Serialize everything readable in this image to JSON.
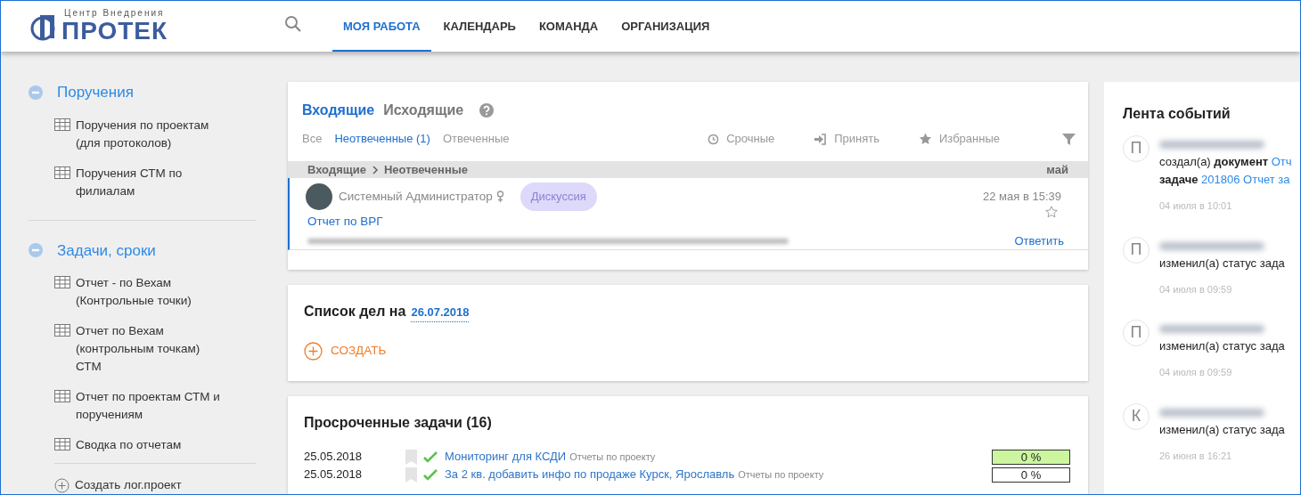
{
  "header": {
    "logo": {
      "subtitle": "Центр Внедрения",
      "name": "ПРОТЕК"
    },
    "nav": [
      {
        "label": "МОЯ РАБОТА",
        "selected": true
      },
      {
        "label": "КАЛЕНДАРЬ",
        "selected": false
      },
      {
        "label": "КОМАНДА",
        "selected": false
      },
      {
        "label": "ОРГАНИЗАЦИЯ",
        "selected": false
      }
    ]
  },
  "sidebar": {
    "sections": [
      {
        "title": "Поручения",
        "expanded": true,
        "items": [
          {
            "label": "Поручения по проектам (для протоколов)"
          },
          {
            "label": "Поручения СТМ по филиалам"
          }
        ]
      },
      {
        "title": "Задачи, сроки",
        "expanded": true,
        "items": [
          {
            "label": "Отчет - по Вехам (Контрольные точки)"
          },
          {
            "label": "Отчет по Вехам (контрольным точкам) СТМ"
          },
          {
            "label": "Отчет по проектам СТМ и поручениям"
          },
          {
            "label": "Сводка по отчетам"
          }
        ]
      }
    ],
    "create_link": "Создать лог.проект"
  },
  "inbox": {
    "tabs": [
      {
        "label": "Входящие",
        "selected": true
      },
      {
        "label": "Исходящие",
        "selected": false
      }
    ],
    "filters": [
      {
        "label": "Все",
        "selected": false
      },
      {
        "label": "Неотвеченные (1)",
        "selected": true
      },
      {
        "label": "Отвеченные",
        "selected": false
      }
    ],
    "actions": [
      {
        "label": "Срочные",
        "kind": "urgent"
      },
      {
        "label": "Принять",
        "kind": "accept"
      },
      {
        "label": "Избранные",
        "kind": "favorite"
      }
    ],
    "breadcrumb": [
      "Входящие",
      "Неотвеченные"
    ],
    "month": "май",
    "messages": [
      {
        "author": "Системный Администратор",
        "tag": "Дискуссия",
        "date": "22 мая в 15:39",
        "subject": "Отчет по ВРГ",
        "starred": false,
        "unread": true,
        "reply": "Ответить"
      }
    ]
  },
  "todo": {
    "title": "Список дел на",
    "date": "26.07.2018",
    "create": "СОЗДАТЬ"
  },
  "overdue": {
    "title": "Просроченные задачи (16)",
    "rows": [
      {
        "date": "25.05.2018",
        "title": "Мониторинг для КСДИ",
        "category": "Отчеты по проекту",
        "progress": "0 %",
        "color": "#ccf5a0"
      },
      {
        "date": "25.05.2018",
        "title": "За 2 кв. добавить инфо по продаже Курск, Ярославль",
        "category": "Отчеты по проекту",
        "progress": "0 %",
        "color": "#ffffff"
      }
    ]
  },
  "feed": {
    "title": "Лента событий",
    "events": [
      {
        "initial": "П",
        "lines": [
          [
            {
              "text": "создал(а) ",
              "kind": "plain"
            },
            {
              "text": "документ",
              "kind": "bold"
            },
            {
              "text": " Отч",
              "kind": "link"
            }
          ],
          [
            {
              "text": "задаче",
              "kind": "bold"
            },
            {
              "text": " 201806 Отчет за",
              "kind": "link"
            }
          ]
        ],
        "time": "04 июля в 10:01"
      },
      {
        "initial": "П",
        "lines": [
          [
            {
              "text": "изменил(а) статус зада",
              "kind": "plain"
            }
          ]
        ],
        "time": "04 июля в 09:59"
      },
      {
        "initial": "П",
        "lines": [
          [
            {
              "text": "изменил(а) статус зада",
              "kind": "plain"
            }
          ]
        ],
        "time": "04 июля в 09:59"
      },
      {
        "initial": "К",
        "lines": [
          [
            {
              "text": "изменил(а) статус зада",
              "kind": "plain"
            }
          ]
        ],
        "time": "26 июня в 16:21"
      }
    ]
  }
}
